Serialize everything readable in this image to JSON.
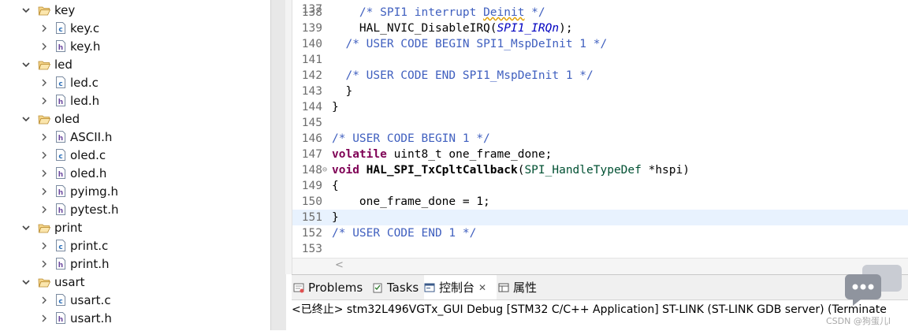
{
  "explorer": {
    "rows": [
      {
        "kind": "folder",
        "label": "key"
      },
      {
        "kind": "file",
        "badge": "c",
        "label": "key.c"
      },
      {
        "kind": "file",
        "badge": "h",
        "label": "key.h"
      },
      {
        "kind": "folder",
        "label": "led"
      },
      {
        "kind": "file",
        "badge": "c",
        "label": "led.c"
      },
      {
        "kind": "file",
        "badge": "h",
        "label": "led.h"
      },
      {
        "kind": "folder",
        "label": "oled"
      },
      {
        "kind": "file",
        "badge": "h",
        "label": "ASCII.h"
      },
      {
        "kind": "file",
        "badge": "c",
        "label": "oled.c"
      },
      {
        "kind": "file",
        "badge": "h",
        "label": "oled.h"
      },
      {
        "kind": "file",
        "badge": "h",
        "label": "pyimg.h"
      },
      {
        "kind": "file",
        "badge": "h",
        "label": "pytest.h"
      },
      {
        "kind": "folder",
        "label": "print"
      },
      {
        "kind": "file",
        "badge": "c",
        "label": "print.c"
      },
      {
        "kind": "file",
        "badge": "h",
        "label": "print.h"
      },
      {
        "kind": "folder",
        "label": "usart"
      },
      {
        "kind": "file",
        "badge": "c",
        "label": "usart.c"
      },
      {
        "kind": "file",
        "badge": "h",
        "label": "usart.h"
      }
    ]
  },
  "editor": {
    "first_partial_line": "137",
    "lines": [
      {
        "num": "138",
        "segments": [
          {
            "t": "    ",
            "c": ""
          },
          {
            "t": "/* SPI1 interrupt ",
            "c": "c-cmt"
          },
          {
            "t": "Deinit",
            "c": "c-cmt c-warn"
          },
          {
            "t": " */",
            "c": "c-cmt"
          }
        ]
      },
      {
        "num": "139",
        "segments": [
          {
            "t": "    HAL_NVIC_DisableIRQ(",
            "c": ""
          },
          {
            "t": "SPI1_IRQn",
            "c": "c-macro"
          },
          {
            "t": ");",
            "c": ""
          }
        ]
      },
      {
        "num": "140",
        "segments": [
          {
            "t": "  ",
            "c": ""
          },
          {
            "t": "/* USER CODE BEGIN SPI1_MspDeInit 1 */",
            "c": "c-cmt"
          }
        ]
      },
      {
        "num": "141",
        "segments": []
      },
      {
        "num": "142",
        "segments": [
          {
            "t": "  ",
            "c": ""
          },
          {
            "t": "/* USER CODE END SPI1_MspDeInit 1 */",
            "c": "c-cmt"
          }
        ]
      },
      {
        "num": "143",
        "segments": [
          {
            "t": "  }",
            "c": ""
          }
        ]
      },
      {
        "num": "144",
        "segments": [
          {
            "t": "}",
            "c": ""
          }
        ]
      },
      {
        "num": "145",
        "segments": []
      },
      {
        "num": "146",
        "segments": [
          {
            "t": "/* USER CODE BEGIN 1 */",
            "c": "c-cmt"
          }
        ]
      },
      {
        "num": "147",
        "segments": [
          {
            "t": "volatile",
            "c": "c-kw"
          },
          {
            "t": " uint8_t one_frame_done;",
            "c": ""
          }
        ]
      },
      {
        "num": "148",
        "fold": "⊖",
        "segments": [
          {
            "t": "void",
            "c": "c-kw"
          },
          {
            "t": " ",
            "c": ""
          },
          {
            "t": "HAL_SPI_TxCpltCallback",
            "c": "c-bold"
          },
          {
            "t": "(",
            "c": ""
          },
          {
            "t": "SPI_HandleTypeDef",
            "c": "c-type"
          },
          {
            "t": " *hspi)",
            "c": ""
          }
        ]
      },
      {
        "num": "149",
        "segments": [
          {
            "t": "{",
            "c": ""
          }
        ]
      },
      {
        "num": "150",
        "segments": [
          {
            "t": "    one_frame_done = 1;",
            "c": ""
          }
        ]
      },
      {
        "num": "151",
        "current": true,
        "segments": [
          {
            "t": "}",
            "c": ""
          }
        ]
      },
      {
        "num": "152",
        "segments": [
          {
            "t": "/* USER CODE END 1 */",
            "c": "c-cmt"
          }
        ]
      },
      {
        "num": "153",
        "segments": []
      }
    ]
  },
  "panel": {
    "tabs": [
      {
        "label": "Problems",
        "icon": "problems-icon"
      },
      {
        "label": "Tasks",
        "icon": "tasks-icon"
      },
      {
        "label": "控制台",
        "icon": "console-icon",
        "active": true,
        "closable": true
      },
      {
        "label": "属性",
        "icon": "properties-icon"
      }
    ],
    "close_glyph": "✕",
    "console_text": "<已终止> stm32L496VGTx_GUI Debug [STM32 C/C++ Application] ST-LINK (ST-LINK GDB server) (Terminate"
  },
  "watermark": "CSDN @狗蛋儿l",
  "colors": {
    "comment": "#3f5fbf",
    "keyword": "#7f0055",
    "macro": "#0000c0",
    "type": "#005032",
    "current_line": "#e8f2fe"
  }
}
